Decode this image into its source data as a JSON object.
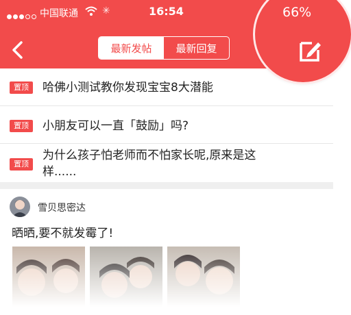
{
  "status_bar": {
    "carrier": "中国联通",
    "time": "16:54",
    "battery": "66%"
  },
  "header": {
    "tabs": [
      {
        "label": "最新发帖",
        "selected": true
      },
      {
        "label": "最新回复",
        "selected": false
      }
    ]
  },
  "pinned_posts": [
    {
      "badge": "置顶",
      "title": "哈佛小测试教你发现宝宝8大潜能"
    },
    {
      "badge": "置顶",
      "title": "小朋友可以一直「鼓励」吗?"
    },
    {
      "badge": "置顶",
      "title_line1": "为什么孩子怕老师而不怕家长呢,原来是这",
      "title_line2": "样......"
    }
  ],
  "post": {
    "author": "雪贝思密达",
    "text": "晒晒,要不就发霉了!"
  },
  "colors": {
    "accent": "#f24b4b",
    "divider": "#e6e6e6",
    "section_gap": "#efefef"
  },
  "icons": [
    "signal-dots-icon",
    "wifi-icon",
    "loading-spinner-icon",
    "back-chevron-icon",
    "compose-icon"
  ]
}
